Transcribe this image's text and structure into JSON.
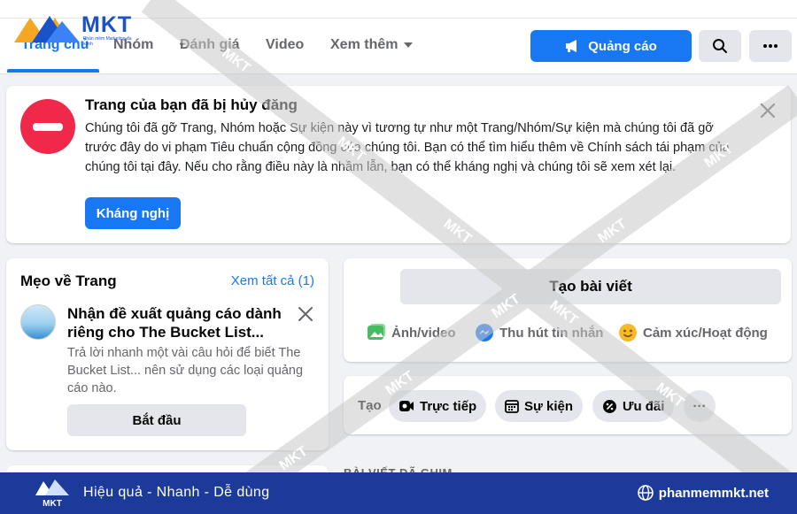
{
  "nav": {
    "tabs": [
      {
        "label": "Trang chủ",
        "active": true
      },
      {
        "label": "Nhóm"
      },
      {
        "label": "Đánh giá"
      },
      {
        "label": "Video"
      },
      {
        "label": "Xem thêm"
      }
    ],
    "ad_button": "Quảng cáo"
  },
  "logo": {
    "text": "MKT",
    "subtext": "Phần mềm Marketing đa kênh"
  },
  "alert": {
    "title": "Trang của bạn đã bị hủy đăng",
    "body": "Chúng tôi đã gỡ Trang, Nhóm hoặc Sự kiện này vì tương tự như một Trang/Nhóm/Sự kiện mà chúng tôi đã gỡ trước đây do vi phạm Tiêu chuẩn cộng đồng của chúng tôi. Bạn có thể tìm hiểu thêm về Chính sách tái phạm của chúng tôi tại đây. Nếu cho rằng điều này là nhầm lẫn, bạn có thể kháng nghị và chúng tôi sẽ xem xét lại.",
    "appeal_button": "Kháng nghị"
  },
  "tips": {
    "title": "Mẹo về Trang",
    "see_all": "Xem tất cả (1)",
    "heading": "Nhận đề xuất quảng cáo dành riêng cho The Bucket List...",
    "body": "Trả lời nhanh một vài câu hỏi để biết The Bucket List... nên sử dụng các loại quảng cáo nào.",
    "start_button": "Bắt đầu"
  },
  "compose": {
    "create_post": "Tạo bài viết",
    "actions": [
      "Ảnh/video",
      "Thu hút tin nhắn",
      "Cảm xúc/Hoạt động"
    ]
  },
  "create_bar": {
    "label": "Tạo",
    "chips": [
      "Trực tiếp",
      "Sự kiện",
      "Ưu đãi"
    ],
    "more": "···"
  },
  "pinned_heading": "BÀI VIẾT ĐÃ GHIM",
  "banner": {
    "tagline": "Hiệu quả - Nhanh - Dễ dùng",
    "url": "phanmemmkt.net"
  },
  "watermark": "MKT",
  "colors": {
    "accent": "#1877f2",
    "danger": "#f02849",
    "banner": "#1b3a9a"
  }
}
